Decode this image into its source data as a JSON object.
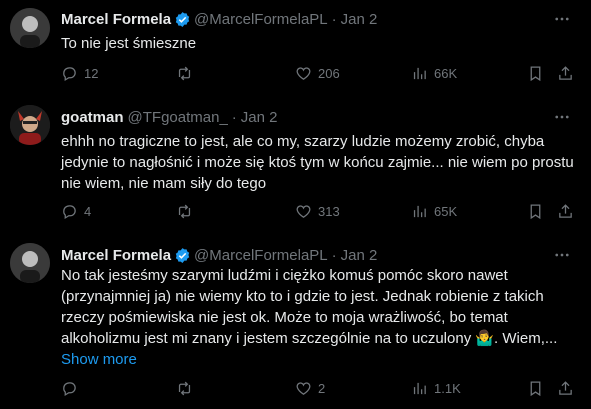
{
  "tweets": [
    {
      "name": "Marcel Formela",
      "handle": "@MarcelFormelaPL",
      "date": "Jan 2",
      "verified": true,
      "text": "To nie jest śmieszne",
      "replies": "12",
      "retweets": "",
      "likes": "206",
      "views": "66K"
    },
    {
      "name": "goatman",
      "handle": "@TFgoatman_",
      "date": "Jan 2",
      "verified": false,
      "text": "ehhh no tragiczne to jest, ale co my, szarzy ludzie możemy zrobić, chyba jedynie to nagłośnić i może się ktoś tym w końcu zajmie... nie wiem po prostu nie wiem, nie mam siły do tego",
      "replies": "4",
      "retweets": "",
      "likes": "313",
      "views": "65K"
    },
    {
      "name": "Marcel Formela",
      "handle": "@MarcelFormelaPL",
      "date": "Jan 2",
      "verified": true,
      "text": "No tak jesteśmy szarymi ludźmi i ciężko komuś pomóc skoro nawet (przynajmniej ja) nie wiemy kto to i gdzie to jest. Jednak robienie z takich rzeczy pośmiewiska nie jest ok. Może to moja wrażliwość, bo temat alkoholizmu jest mi znany i jestem szczególnie na to uczulony 🤷‍♂️. Wiem,...",
      "show_more": "Show more",
      "replies": "",
      "retweets": "",
      "likes": "2",
      "views": "1.1K"
    }
  ],
  "icons": {
    "reply": "reply-icon",
    "retweet": "retweet-icon",
    "like": "heart-icon",
    "views": "views-icon",
    "bookmark": "bookmark-icon",
    "share": "share-icon",
    "more": "more-icon",
    "verified": "verified-badge-icon"
  },
  "colors": {
    "background": "#000000",
    "text": "#e7e9ea",
    "muted": "#71767b",
    "accent": "#1d9bf0"
  }
}
